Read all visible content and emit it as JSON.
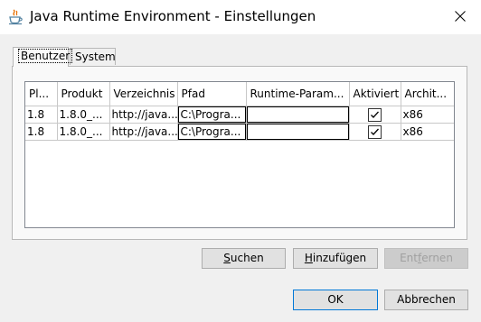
{
  "window": {
    "title": "Java Runtime Environment - Einstellungen",
    "close_icon": "close-icon",
    "app_icon": "java-icon"
  },
  "tabs": [
    {
      "label": "Benutzer",
      "active": true
    },
    {
      "label": "System",
      "active": false
    }
  ],
  "table": {
    "columns": [
      "Pl...",
      "Produkt",
      "Verzeichnis",
      "Pfad",
      "Runtime-Param...",
      "Aktiviert",
      "Archit..."
    ],
    "rows": [
      {
        "platform": "1.8",
        "product": "1.8.0_...",
        "location": "http://java...",
        "path": "C:\\Progra...",
        "params": "",
        "enabled": true,
        "arch": "x86"
      },
      {
        "platform": "1.8",
        "product": "1.8.0_...",
        "location": "http://java...",
        "path": "C:\\Progra...",
        "params": "",
        "enabled": true,
        "arch": "x86"
      }
    ]
  },
  "buttons": {
    "search": {
      "label_pre": "",
      "mnemonic": "S",
      "label_post": "uchen"
    },
    "add": {
      "label_pre": "",
      "mnemonic": "H",
      "label_post": "inzufügen"
    },
    "remove": {
      "label_pre": "Ent",
      "mnemonic": "f",
      "label_post": "ernen",
      "disabled": true
    },
    "ok": {
      "label": "OK"
    },
    "cancel": {
      "label": "Abbrechen"
    }
  }
}
